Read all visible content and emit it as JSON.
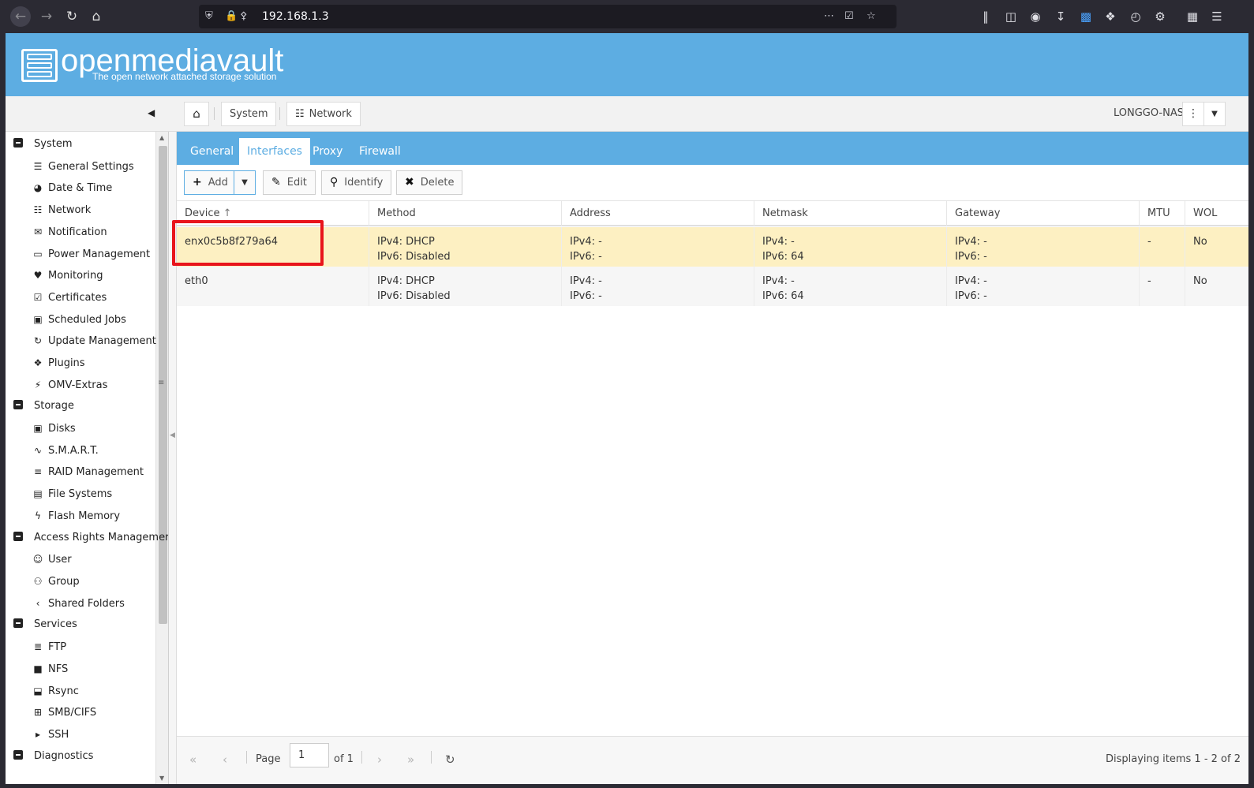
{
  "browser": {
    "url": "192.168.1.3"
  },
  "app": {
    "brand": "openmediavault",
    "tagline": "The open network attached storage solution",
    "hostname": "LONGGO-NAS",
    "breadcrumb": [
      "System",
      "Network"
    ]
  },
  "sidebar": {
    "groups": [
      {
        "label": "System",
        "items": [
          {
            "label": "General Settings",
            "icon": "sliders-icon"
          },
          {
            "label": "Date & Time",
            "icon": "clock-icon"
          },
          {
            "label": "Network",
            "icon": "network-icon"
          },
          {
            "label": "Notification",
            "icon": "envelope-icon"
          },
          {
            "label": "Power Management",
            "icon": "battery-icon"
          },
          {
            "label": "Monitoring",
            "icon": "heartbeat-icon"
          },
          {
            "label": "Certificates",
            "icon": "certificate-icon"
          },
          {
            "label": "Scheduled Jobs",
            "icon": "calendar-clock-icon"
          },
          {
            "label": "Update Management",
            "icon": "sync-icon"
          },
          {
            "label": "Plugins",
            "icon": "puzzle-icon"
          },
          {
            "label": "OMV-Extras",
            "icon": "plug-icon"
          }
        ]
      },
      {
        "label": "Storage",
        "items": [
          {
            "label": "Disks",
            "icon": "disk-icon"
          },
          {
            "label": "S.M.A.R.T.",
            "icon": "pulse-icon"
          },
          {
            "label": "RAID Management",
            "icon": "database-icon"
          },
          {
            "label": "File Systems",
            "icon": "folders-icon"
          },
          {
            "label": "Flash Memory",
            "icon": "bolt-icon"
          }
        ]
      },
      {
        "label": "Access Rights Managemer",
        "items": [
          {
            "label": "User",
            "icon": "user-icon"
          },
          {
            "label": "Group",
            "icon": "users-icon"
          },
          {
            "label": "Shared Folders",
            "icon": "share-icon"
          }
        ]
      },
      {
        "label": "Services",
        "items": [
          {
            "label": "FTP",
            "icon": "server-icon"
          },
          {
            "label": "NFS",
            "icon": "nfs-icon"
          },
          {
            "label": "Rsync",
            "icon": "rsync-icon"
          },
          {
            "label": "SMB/CIFS",
            "icon": "windows-icon"
          },
          {
            "label": "SSH",
            "icon": "terminal-icon"
          }
        ]
      },
      {
        "label": "Diagnostics",
        "items": []
      }
    ]
  },
  "tabs": [
    "General",
    "Interfaces",
    "Proxy",
    "Firewall"
  ],
  "active_tab": "Interfaces",
  "actions": {
    "add": "Add",
    "edit": "Edit",
    "identify": "Identify",
    "delete": "Delete"
  },
  "grid": {
    "columns": [
      "Device",
      "Method",
      "Address",
      "Netmask",
      "Gateway",
      "MTU",
      "WOL"
    ],
    "rows": [
      {
        "device": "enx0c5b8f279a64",
        "method": [
          "IPv4: DHCP",
          "IPv6: Disabled"
        ],
        "address": [
          "IPv4: -",
          "IPv6: -"
        ],
        "netmask": [
          "IPv4: -",
          "IPv6: 64"
        ],
        "gateway": [
          "IPv4: -",
          "IPv6: -"
        ],
        "mtu": "-",
        "wol": "No"
      },
      {
        "device": "eth0",
        "method": [
          "IPv4: DHCP",
          "IPv6: Disabled"
        ],
        "address": [
          "IPv4: -",
          "IPv6: -"
        ],
        "netmask": [
          "IPv4: -",
          "IPv6: 64"
        ],
        "gateway": [
          "IPv4: -",
          "IPv6: -"
        ],
        "mtu": "-",
        "wol": "No"
      }
    ]
  },
  "pager": {
    "page_label": "Page",
    "page_value": "1",
    "of_label": "of 1",
    "display_text": "Displaying items 1 - 2 of 2"
  },
  "colors": {
    "header": "#5dade2",
    "selected_row": "#fdf0c2",
    "highlight_box": "#e8141c"
  }
}
